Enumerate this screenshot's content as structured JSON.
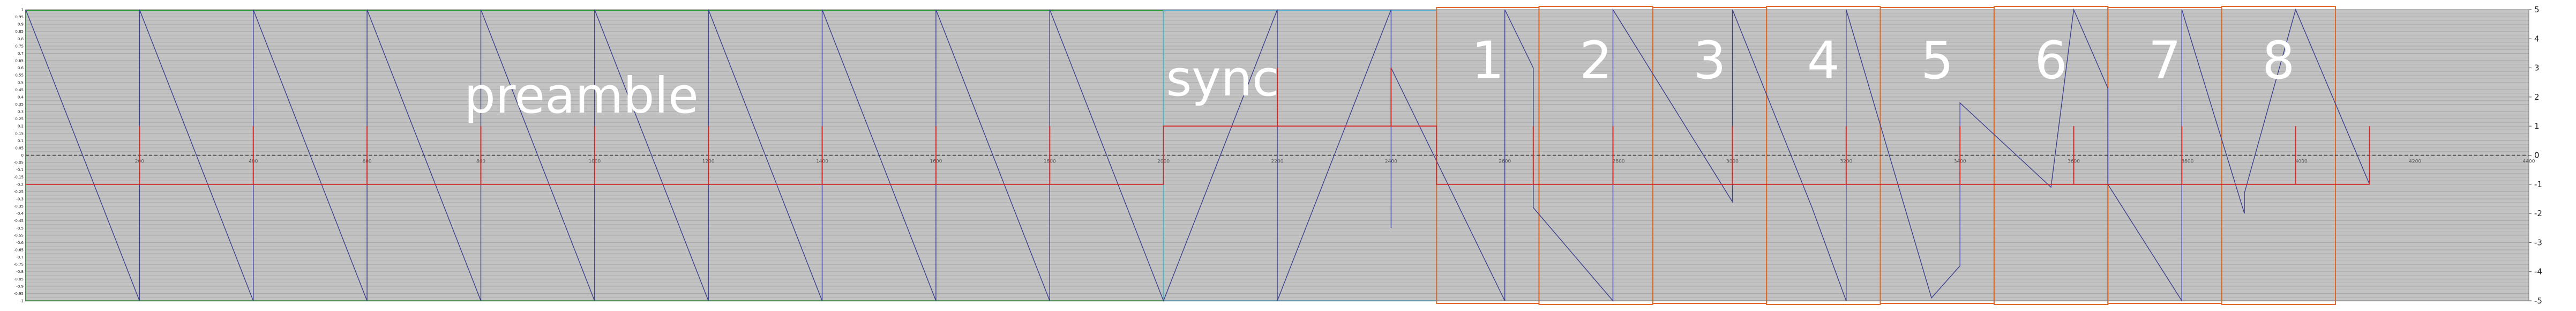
{
  "chart_data": {
    "type": "line",
    "title": "",
    "xlabel": "",
    "ylabel": "",
    "xlim": [
      0,
      4400
    ],
    "ylim": [
      -5,
      5
    ],
    "grid": true,
    "legend": "none",
    "left_ylim": [
      -1,
      1
    ],
    "left_y_ticks": [
      "1",
      "0.95",
      "0.9",
      "0.85",
      "0.8",
      "0.75",
      "0.7",
      "0.65",
      "0.6",
      "0.55",
      "0.5",
      "0.45",
      "0.4",
      "0.35",
      "0.3",
      "0.25",
      "0.2",
      "0.15",
      "0.1",
      "0.05",
      "0",
      "-0.05",
      "-0.1",
      "-0.15",
      "-0.2",
      "-0.25",
      "-0.3",
      "-0.35",
      "-0.4",
      "-0.45",
      "-0.5",
      "-0.55",
      "-0.6",
      "-0.65",
      "-0.7",
      "-0.75",
      "-0.8",
      "-0.85",
      "-0.9",
      "-0.95",
      "-1"
    ],
    "right_y_ticks": [
      "5",
      "4",
      "3",
      "2",
      "1",
      "0",
      "-1",
      "-2",
      "-3",
      "-4",
      "-5"
    ],
    "x_ticks": [
      "200",
      "400",
      "600",
      "800",
      "1000",
      "1200",
      "1400",
      "1600",
      "1800",
      "2000",
      "2200",
      "2400",
      "2600",
      "2800",
      "3000",
      "3200",
      "3400",
      "3600",
      "3800",
      "4000",
      "4200",
      "4400"
    ],
    "series": [
      {
        "color": "#3b3f8c",
        "points": [
          [
            0,
            5
          ],
          [
            200,
            -5
          ],
          [
            200,
            5
          ],
          [
            400,
            -5
          ],
          [
            400,
            5
          ],
          [
            600,
            -5
          ],
          [
            600,
            5
          ],
          [
            800,
            -5
          ],
          [
            800,
            5
          ],
          [
            1000,
            -5
          ],
          [
            1000,
            5
          ],
          [
            1200,
            -5
          ],
          [
            1200,
            5
          ],
          [
            1400,
            -5
          ],
          [
            1400,
            5
          ],
          [
            1600,
            -5
          ],
          [
            1600,
            5
          ],
          [
            1800,
            -5
          ],
          [
            1800,
            5
          ],
          [
            2000,
            -5
          ],
          [
            2200,
            5
          ],
          [
            2200,
            -5
          ],
          [
            2400,
            5
          ],
          [
            2400,
            -2.5
          ],
          [
            2400,
            3
          ],
          [
            2600,
            -5
          ],
          [
            2600,
            5
          ],
          [
            2650,
            3
          ],
          [
            2650,
            -1.8
          ],
          [
            2790,
            -5
          ],
          [
            2790,
            5
          ],
          [
            3000,
            -1.6
          ],
          [
            3000,
            5
          ],
          [
            3140,
            -1.8
          ],
          [
            3200,
            -5
          ],
          [
            3200,
            5
          ],
          [
            3350,
            -4.9
          ],
          [
            3400,
            -3.8
          ],
          [
            3400,
            1.8
          ],
          [
            3560,
            -1.1
          ],
          [
            3600,
            5
          ],
          [
            3660,
            2.3
          ],
          [
            3660,
            -1
          ],
          [
            3790,
            -5
          ],
          [
            3790,
            5
          ],
          [
            3900,
            -2
          ],
          [
            3900,
            -1.3
          ],
          [
            3990,
            5
          ],
          [
            4120,
            -1
          ]
        ]
      },
      {
        "color": "#d42a2a",
        "points": [
          [
            0,
            -1
          ],
          [
            2000,
            -1
          ],
          [
            2000,
            1
          ],
          [
            2480,
            1
          ],
          [
            2480,
            -1
          ],
          [
            4120,
            -1
          ]
        ],
        "spikes_x": [
          200,
          400,
          600,
          800,
          1000,
          1200,
          1400,
          1600,
          1800,
          2200,
          2400,
          2650,
          2790,
          3000,
          3200,
          3400,
          3600,
          3790,
          3990,
          4120
        ]
      }
    ],
    "regions": [
      {
        "label": "preamble",
        "x0": 0,
        "x1": 2000,
        "color": "#2e9a3a"
      },
      {
        "label": "sync",
        "x0": 2000,
        "x1": 2480,
        "color": "#5aaecf"
      },
      {
        "label": "1",
        "x0": 2480,
        "x1": 2660,
        "color": "#e06a2a"
      },
      {
        "label": "2",
        "x0": 2660,
        "x1": 2860,
        "color": "#e06a2a"
      },
      {
        "label": "3",
        "x0": 2860,
        "x1": 3060,
        "color": "#e06a2a"
      },
      {
        "label": "4",
        "x0": 3060,
        "x1": 3260,
        "color": "#e06a2a"
      },
      {
        "label": "5",
        "x0": 3260,
        "x1": 3460,
        "color": "#e06a2a"
      },
      {
        "label": "6",
        "x0": 3460,
        "x1": 3660,
        "color": "#e06a2a"
      },
      {
        "label": "7",
        "x0": 3660,
        "x1": 3860,
        "color": "#e06a2a"
      },
      {
        "label": "8",
        "x0": 3860,
        "x1": 4060,
        "color": "#e06a2a"
      }
    ]
  }
}
